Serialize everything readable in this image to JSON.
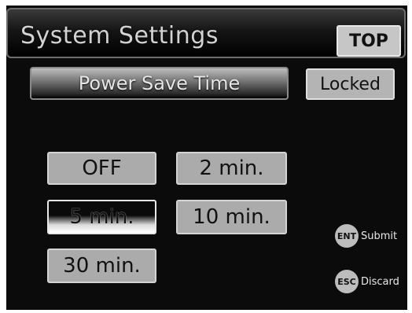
{
  "header": {
    "title": "System Settings",
    "top_label": "TOP"
  },
  "setting": {
    "name": "Power Save Time",
    "status": "Locked"
  },
  "options": {
    "off": "OFF",
    "two_min": "2 min.",
    "five_min": "5 min.",
    "ten_min": "10 min.",
    "thirty_min": "30 min.",
    "selected": "5 min."
  },
  "hints": {
    "ent_key": "ENT",
    "ent_label": "Submit",
    "esc_key": "ESC",
    "esc_label": "Discard"
  }
}
